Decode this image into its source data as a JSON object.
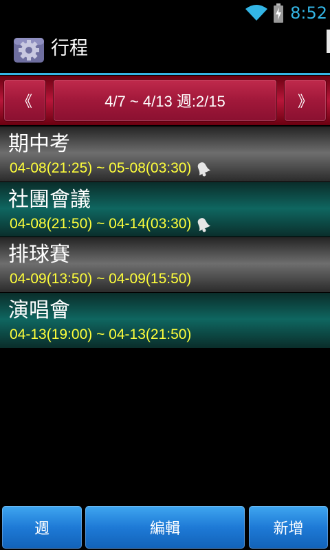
{
  "status_bar": {
    "time": "8:52"
  },
  "header": {
    "title": "行程"
  },
  "week_nav": {
    "prev": "《",
    "range": "4/7 ~ 4/13 週:2/15",
    "next": "》"
  },
  "events": [
    {
      "title": "期中考",
      "time": "04-08(21:25) ~ 05-08(03:30)",
      "alarm": true
    },
    {
      "title": "社團會議",
      "time": "04-08(21:50) ~ 04-14(03:30)",
      "alarm": true
    },
    {
      "title": "排球賽",
      "time": "04-09(13:50) ~ 04-09(15:50)",
      "alarm": false
    },
    {
      "title": "演唱會",
      "time": "04-13(19:00) ~ 04-13(21:50)",
      "alarm": false
    }
  ],
  "bottom": {
    "week": "週",
    "edit": "編輯",
    "add": "新增"
  },
  "colors": {
    "accent": "#33b5e5",
    "time_text": "#ffff3b",
    "nav_red": "#b8163a",
    "button_blue": "#1e7ad6"
  },
  "icons": {
    "app": "settings-gear-icon",
    "alarm": "bell-icon"
  }
}
